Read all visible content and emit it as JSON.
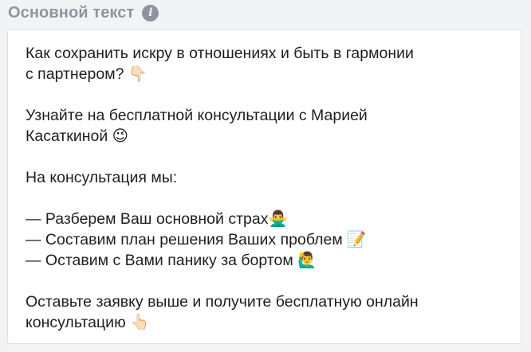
{
  "field": {
    "label": "Основной текст",
    "info_icon": "info-icon",
    "info_glyph": "i"
  },
  "textarea": {
    "lines": [
      "Как сохранить искру в отношениях и быть в гармонии",
      "с партнером? 👇🏻",
      "",
      "Узнайте на бесплатной консультации с Марией",
      "Касаткиной 😉",
      "",
      "На консультация мы:",
      "",
      "— Разберем Ваш основной страх🙅‍♂️",
      "— Составим план решения Ваших проблем 📝",
      "— Оставим с Вами панику за бортом 🙋‍♂️",
      "",
      "Оставьте заявку выше и получите бесплатную онлайн",
      "консультацию 👆🏻"
    ]
  }
}
